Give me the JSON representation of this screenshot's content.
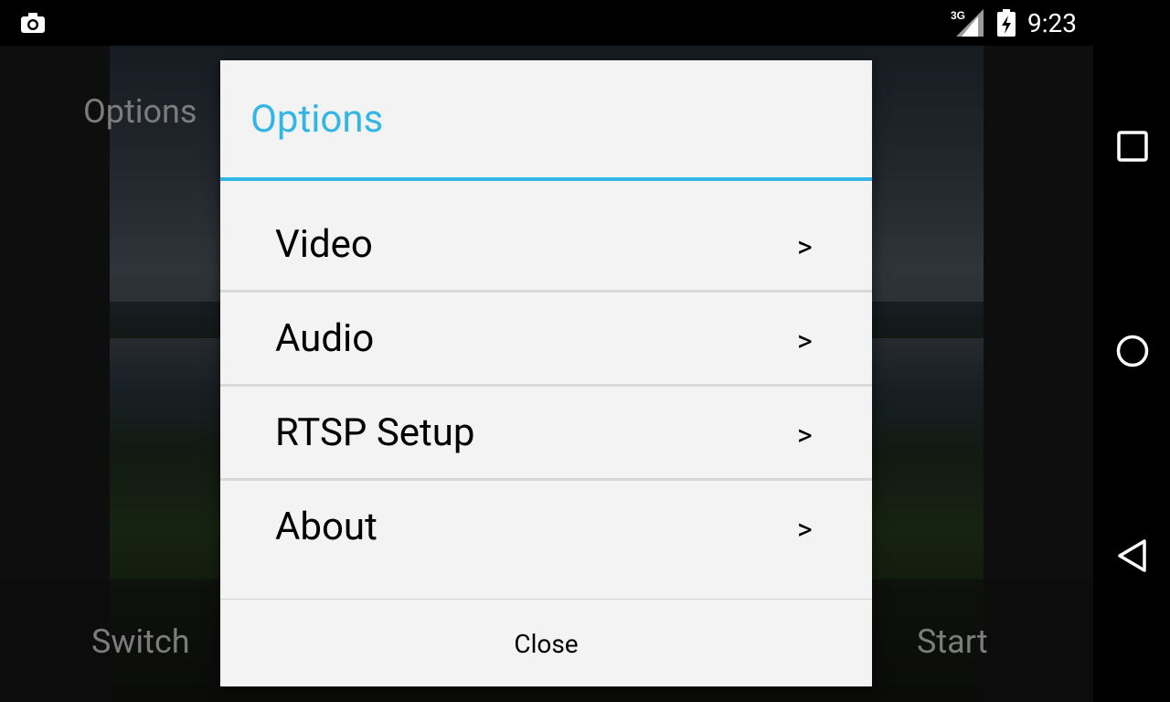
{
  "status_bar": {
    "time": "9:23",
    "network_type": "3G",
    "icons": [
      "screenshot-camera-icon",
      "signal-3g-icon",
      "battery-charging-icon"
    ]
  },
  "background_app": {
    "options_label": "Options",
    "switch_label": "Switch",
    "start_label": "Start"
  },
  "dialog": {
    "title": "Options",
    "accent_color": "#33b5e5",
    "items": [
      {
        "label": "Video",
        "chevron": ">"
      },
      {
        "label": "Audio",
        "chevron": ">"
      },
      {
        "label": "RTSP Setup",
        "chevron": ">"
      },
      {
        "label": "About",
        "chevron": ">"
      }
    ],
    "close_label": "Close"
  },
  "navigation_bar": {
    "buttons": [
      "recents-square-icon",
      "home-circle-icon",
      "back-triangle-icon"
    ]
  }
}
